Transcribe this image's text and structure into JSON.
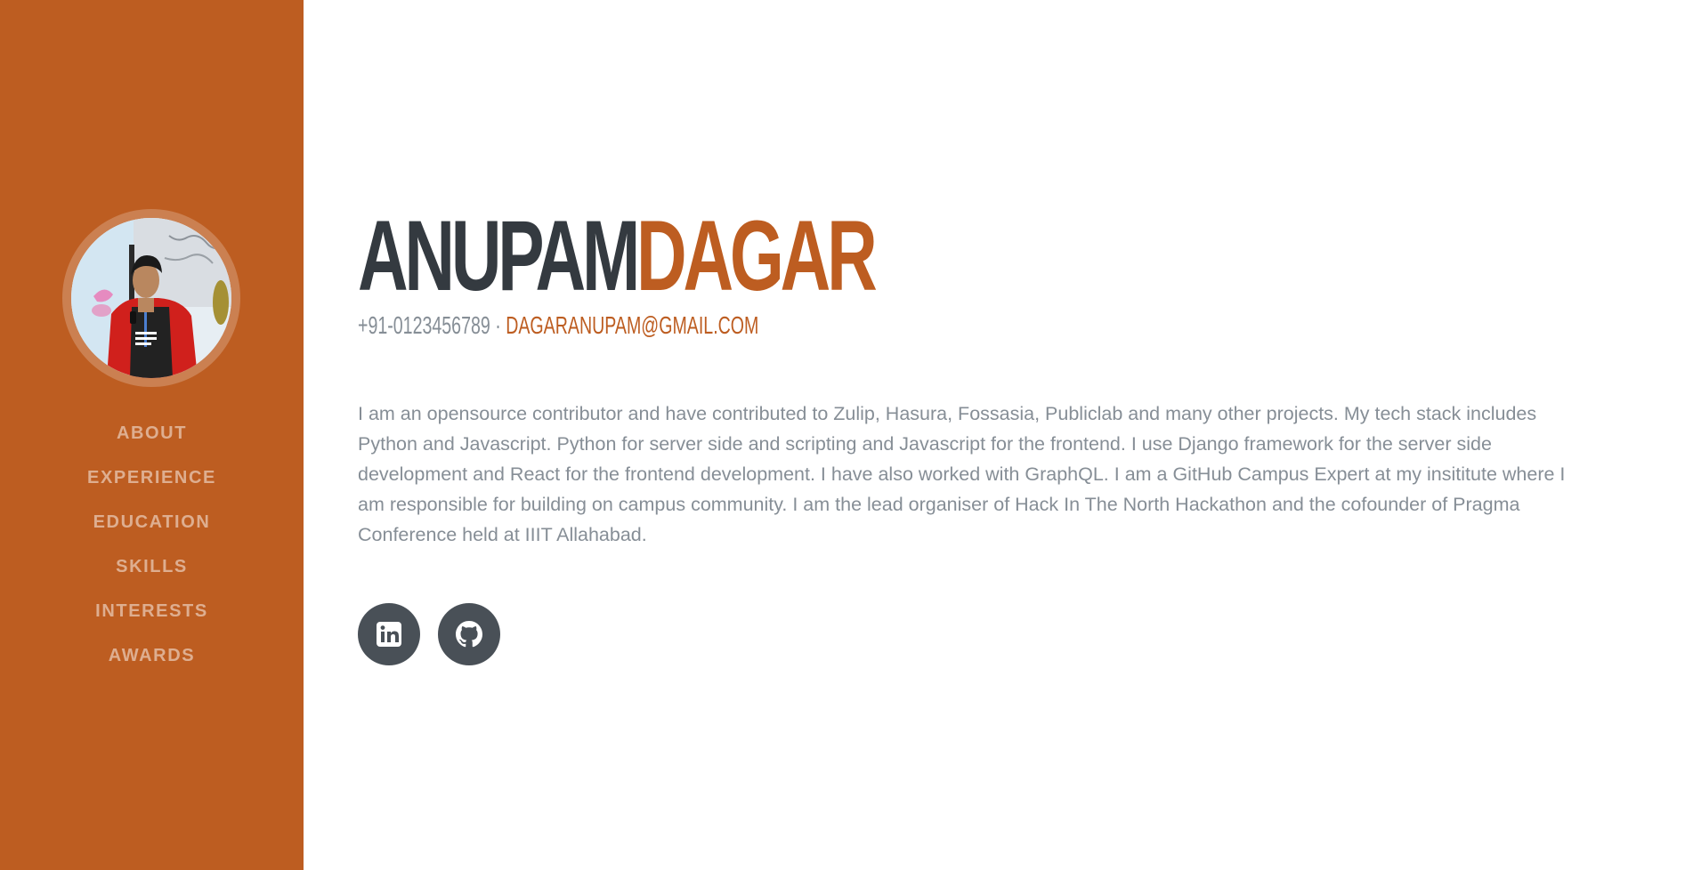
{
  "profile": {
    "first_name": "ANUPAM",
    "last_name": "DAGAR",
    "phone": "+91-0123456789 ·",
    "email": "dagaranupam@gmail.com",
    "about": "I am an opensource contributor and have contributed to Zulip, Hasura, Fossasia, Publiclab and many other projects. My tech stack includes Python and Javascript. Python for server side and scripting and Javascript for the frontend. I use Django framework for the server side development and React for the frontend development. I have also worked with GraphQL. I am a GitHub Campus Expert at my insititute where I am responsible for building on campus community. I am the lead organiser of Hack In The North Hackathon and the cofounder of Pragma Conference held at IIIT Allahabad."
  },
  "nav": {
    "items": [
      {
        "label": "ABOUT"
      },
      {
        "label": "EXPERIENCE"
      },
      {
        "label": "EDUCATION"
      },
      {
        "label": "SKILLS"
      },
      {
        "label": "INTERESTS"
      },
      {
        "label": "AWARDS"
      }
    ]
  },
  "social": {
    "items": [
      {
        "icon": "linkedin-icon"
      },
      {
        "icon": "github-icon"
      }
    ]
  },
  "colors": {
    "primary": "#bd5d21",
    "dark": "#343a40",
    "muted": "#868e96",
    "social_bg": "#495057"
  }
}
